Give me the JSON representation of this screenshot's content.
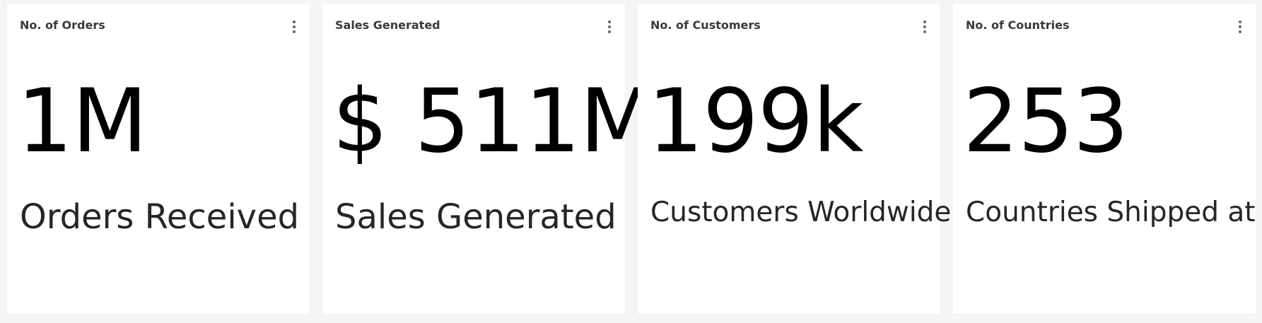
{
  "cards": [
    {
      "title": "No. of Orders",
      "value": "1M",
      "label": "Orders Received"
    },
    {
      "title": "Sales Generated",
      "value": "$ 511M",
      "label": "Sales Generated"
    },
    {
      "title": "No. of Customers",
      "value": "199k",
      "label": "Customers Worldwide"
    },
    {
      "title": "No. of Countries",
      "value": "253",
      "label": "Countries Shipped at"
    }
  ],
  "icons": {
    "menu": "more-vertical-icon"
  },
  "colors": {
    "page_background": "#f5f5f5",
    "card_background": "#ffffff",
    "title_text": "#3a3a3a",
    "value_text": "#000000",
    "label_text": "#262626",
    "menu_icon": "#666666"
  }
}
